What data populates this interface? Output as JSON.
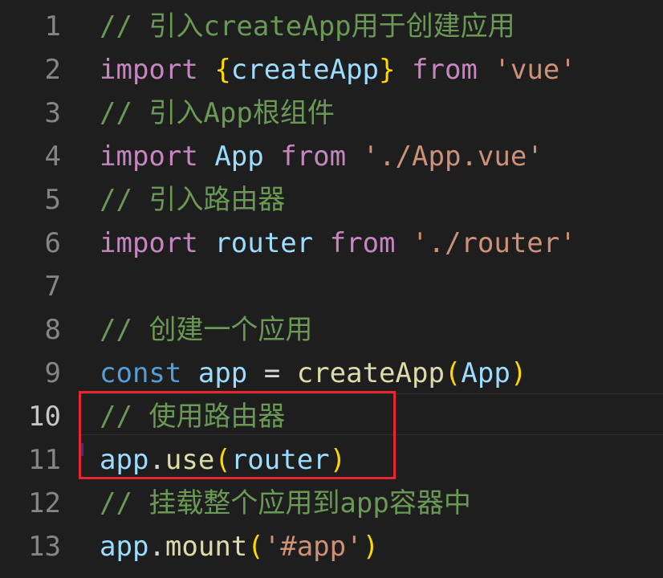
{
  "editor": {
    "lines": [
      {
        "number": "1",
        "tokens": [
          {
            "text": "// 引入createApp用于创建应用",
            "kind": "comment"
          }
        ]
      },
      {
        "number": "2",
        "tokens": [
          {
            "text": "import",
            "kind": "keyword"
          },
          {
            "text": " ",
            "kind": "plain"
          },
          {
            "text": "{",
            "kind": "brace"
          },
          {
            "text": "createApp",
            "kind": "var"
          },
          {
            "text": "}",
            "kind": "brace"
          },
          {
            "text": " ",
            "kind": "plain"
          },
          {
            "text": "from",
            "kind": "keyword"
          },
          {
            "text": " ",
            "kind": "plain"
          },
          {
            "text": "'vue'",
            "kind": "string"
          }
        ]
      },
      {
        "number": "3",
        "tokens": [
          {
            "text": "// 引入App根组件",
            "kind": "comment"
          }
        ]
      },
      {
        "number": "4",
        "tokens": [
          {
            "text": "import",
            "kind": "keyword"
          },
          {
            "text": " ",
            "kind": "plain"
          },
          {
            "text": "App",
            "kind": "var"
          },
          {
            "text": " ",
            "kind": "plain"
          },
          {
            "text": "from",
            "kind": "keyword"
          },
          {
            "text": " ",
            "kind": "plain"
          },
          {
            "text": "'./App.vue'",
            "kind": "string"
          }
        ]
      },
      {
        "number": "5",
        "tokens": [
          {
            "text": "// 引入路由器",
            "kind": "comment"
          }
        ]
      },
      {
        "number": "6",
        "tokens": [
          {
            "text": "import",
            "kind": "keyword"
          },
          {
            "text": " ",
            "kind": "plain"
          },
          {
            "text": "router",
            "kind": "var"
          },
          {
            "text": " ",
            "kind": "plain"
          },
          {
            "text": "from",
            "kind": "keyword"
          },
          {
            "text": " ",
            "kind": "plain"
          },
          {
            "text": "'./router'",
            "kind": "string"
          }
        ]
      },
      {
        "number": "7",
        "tokens": []
      },
      {
        "number": "8",
        "tokens": [
          {
            "text": "// 创建一个应用",
            "kind": "comment"
          }
        ]
      },
      {
        "number": "9",
        "tokens": [
          {
            "text": "const",
            "kind": "storage"
          },
          {
            "text": " ",
            "kind": "plain"
          },
          {
            "text": "app",
            "kind": "var"
          },
          {
            "text": " = ",
            "kind": "plain"
          },
          {
            "text": "createApp",
            "kind": "func"
          },
          {
            "text": "(",
            "kind": "brace"
          },
          {
            "text": "App",
            "kind": "var"
          },
          {
            "text": ")",
            "kind": "brace"
          }
        ]
      },
      {
        "number": "10",
        "active": true,
        "tokens": [
          {
            "text": "// 使用路由器",
            "kind": "comment"
          }
        ]
      },
      {
        "number": "11",
        "tokens": [
          {
            "text": "app",
            "kind": "var"
          },
          {
            "text": ".",
            "kind": "plain"
          },
          {
            "text": "use",
            "kind": "func"
          },
          {
            "text": "(",
            "kind": "brace"
          },
          {
            "text": "router",
            "kind": "var"
          },
          {
            "text": ")",
            "kind": "brace"
          }
        ]
      },
      {
        "number": "12",
        "tokens": [
          {
            "text": "// 挂载整个应用到app容器中",
            "kind": "comment"
          }
        ]
      },
      {
        "number": "13",
        "tokens": [
          {
            "text": "app",
            "kind": "var"
          },
          {
            "text": ".",
            "kind": "plain"
          },
          {
            "text": "mount",
            "kind": "func"
          },
          {
            "text": "(",
            "kind": "brace"
          },
          {
            "text": "'#app'",
            "kind": "string"
          },
          {
            "text": ")",
            "kind": "brace"
          }
        ]
      }
    ]
  },
  "colors": {
    "background": "#1e1e1e",
    "highlight_box": "#e8262d",
    "comment": "#6a9955",
    "keyword": "#c586c0",
    "variable": "#9cdcfe",
    "string": "#ce9178",
    "bracket": "#ffd700"
  }
}
